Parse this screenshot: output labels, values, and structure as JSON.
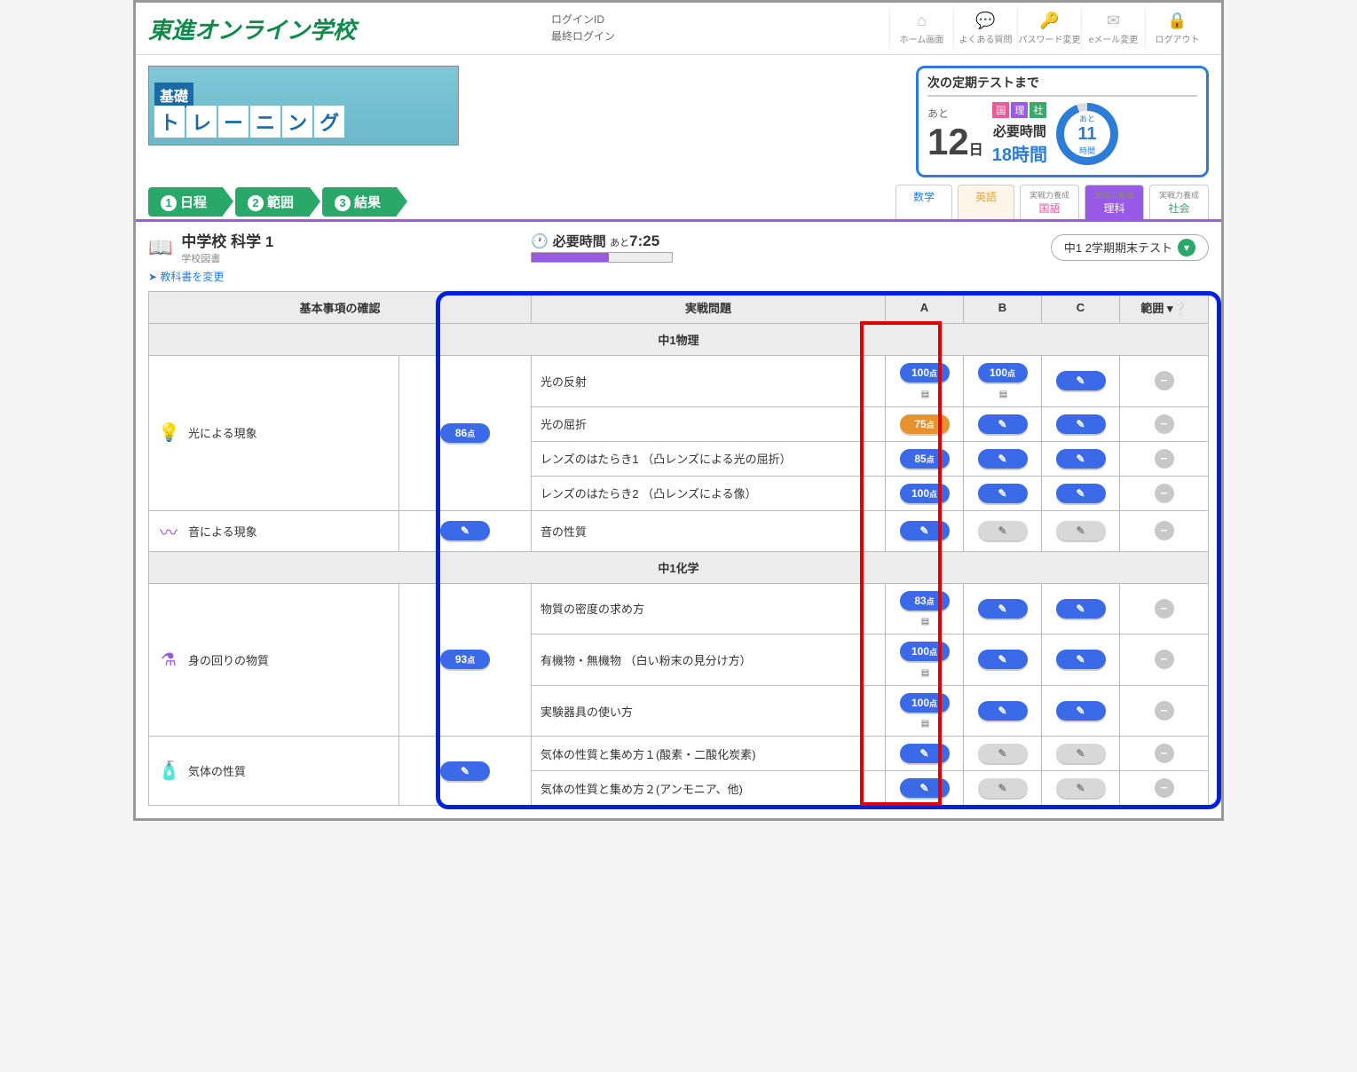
{
  "header": {
    "site_name": "東進オンライン学校",
    "login_id_label": "ログインID",
    "last_login_label": "最終ログイン",
    "nav": [
      {
        "icon": "⌂",
        "label": "ホーム画面"
      },
      {
        "icon": "💬",
        "label": "よくある質問"
      },
      {
        "icon": "🔑",
        "label": "パスワード変更"
      },
      {
        "icon": "✉",
        "label": "eメール変更"
      },
      {
        "icon": "🔒",
        "label": "ログアウト"
      }
    ]
  },
  "banner": {
    "pre": "基礎",
    "tiles": [
      "ト",
      "レ",
      "ー",
      "ニ",
      "ン",
      "グ"
    ]
  },
  "countdown": {
    "title": "次の定期テストまで",
    "ato": "あと",
    "days": "12",
    "days_unit": "日",
    "badges": [
      "国",
      "理",
      "社"
    ],
    "need_label": "必要時間",
    "need_value": "18時間",
    "ring_ato": "あと",
    "ring_num": "11",
    "ring_unit": "時間"
  },
  "steps": [
    {
      "n": "1",
      "label": "日程"
    },
    {
      "n": "2",
      "label": "範囲"
    },
    {
      "n": "3",
      "label": "結果"
    }
  ],
  "subject_tabs": [
    {
      "cls": "math",
      "label": "数学",
      "small": ""
    },
    {
      "cls": "eng",
      "label": "英語",
      "small": ""
    },
    {
      "cls": "kok",
      "label": "国語",
      "small": "実戦力養成"
    },
    {
      "cls": "sci",
      "label": "理科",
      "small": "実戦力養成"
    },
    {
      "cls": "soc",
      "label": "社会",
      "small": "実戦力養成"
    }
  ],
  "course": {
    "title": "中学校 科学 1",
    "subtitle": "学校図書",
    "time_label": "必要時間",
    "time_small": "あと",
    "time_value": "7:25",
    "change_link": "教科書を変更",
    "term_selected": "中1 2学期期末テスト"
  },
  "columns": {
    "basic": "基本事項の確認",
    "practice": "実戦問題",
    "A": "A",
    "B": "B",
    "C": "C",
    "range": "範囲"
  },
  "sections": [
    {
      "header": "中1物理",
      "topics": [
        {
          "icon": "💡",
          "name": "光による現象",
          "basic": {
            "type": "score",
            "value": "86",
            "cls": "blue"
          },
          "rows": [
            {
              "title": "光の反射",
              "A": {
                "type": "score",
                "value": "100",
                "cls": "blue",
                "note": true
              },
              "B": {
                "type": "score",
                "value": "100",
                "cls": "blue",
                "note": true
              },
              "C": {
                "type": "pen",
                "cls": "blue"
              }
            },
            {
              "title": "光の屈折",
              "A": {
                "type": "score",
                "value": "75",
                "cls": "orange"
              },
              "B": {
                "type": "pen",
                "cls": "blue"
              },
              "C": {
                "type": "pen",
                "cls": "blue"
              }
            },
            {
              "title": "レンズのはたらき1 （凸レンズによる光の屈折）",
              "A": {
                "type": "score",
                "value": "85",
                "cls": "blue"
              },
              "B": {
                "type": "pen",
                "cls": "blue"
              },
              "C": {
                "type": "pen",
                "cls": "blue"
              }
            },
            {
              "title": "レンズのはたらき2 （凸レンズによる像）",
              "A": {
                "type": "score",
                "value": "100",
                "cls": "blue"
              },
              "B": {
                "type": "pen",
                "cls": "blue"
              },
              "C": {
                "type": "pen",
                "cls": "blue"
              }
            }
          ]
        },
        {
          "icon": "〰",
          "name": "音による現象",
          "basic": {
            "type": "pen",
            "cls": "blue"
          },
          "rows": [
            {
              "title": "音の性質",
              "A": {
                "type": "pen",
                "cls": "blue"
              },
              "B": {
                "type": "pen",
                "cls": "gray"
              },
              "C": {
                "type": "pen",
                "cls": "gray"
              }
            }
          ]
        }
      ]
    },
    {
      "header": "中1化学",
      "topics": [
        {
          "icon": "⚗",
          "name": "身の回りの物質",
          "basic": {
            "type": "score",
            "value": "93",
            "cls": "blue"
          },
          "rows": [
            {
              "title": "物質の密度の求め方",
              "A": {
                "type": "score",
                "value": "83",
                "cls": "blue",
                "note": true
              },
              "B": {
                "type": "pen",
                "cls": "blue"
              },
              "C": {
                "type": "pen",
                "cls": "blue"
              }
            },
            {
              "title": "有機物・無機物 （白い粉末の見分け方）",
              "A": {
                "type": "score",
                "value": "100",
                "cls": "blue",
                "note": true
              },
              "B": {
                "type": "pen",
                "cls": "blue"
              },
              "C": {
                "type": "pen",
                "cls": "blue"
              }
            },
            {
              "title": "実験器具の使い方",
              "A": {
                "type": "score",
                "value": "100",
                "cls": "blue",
                "note": true
              },
              "B": {
                "type": "pen",
                "cls": "blue"
              },
              "C": {
                "type": "pen",
                "cls": "blue"
              }
            }
          ]
        },
        {
          "icon": "🧴",
          "name": "気体の性質",
          "basic": {
            "type": "pen",
            "cls": "blue"
          },
          "rows": [
            {
              "title": "気体の性質と集め方１(酸素・二酸化炭素)",
              "A": {
                "type": "pen",
                "cls": "blue"
              },
              "B": {
                "type": "pen",
                "cls": "gray"
              },
              "C": {
                "type": "pen",
                "cls": "gray"
              }
            },
            {
              "title": "気体の性質と集め方２(アンモニア、他)",
              "A": {
                "type": "pen",
                "cls": "blue"
              },
              "B": {
                "type": "pen",
                "cls": "gray"
              },
              "C": {
                "type": "pen",
                "cls": "gray"
              }
            }
          ]
        }
      ]
    }
  ],
  "points_suffix": "点"
}
